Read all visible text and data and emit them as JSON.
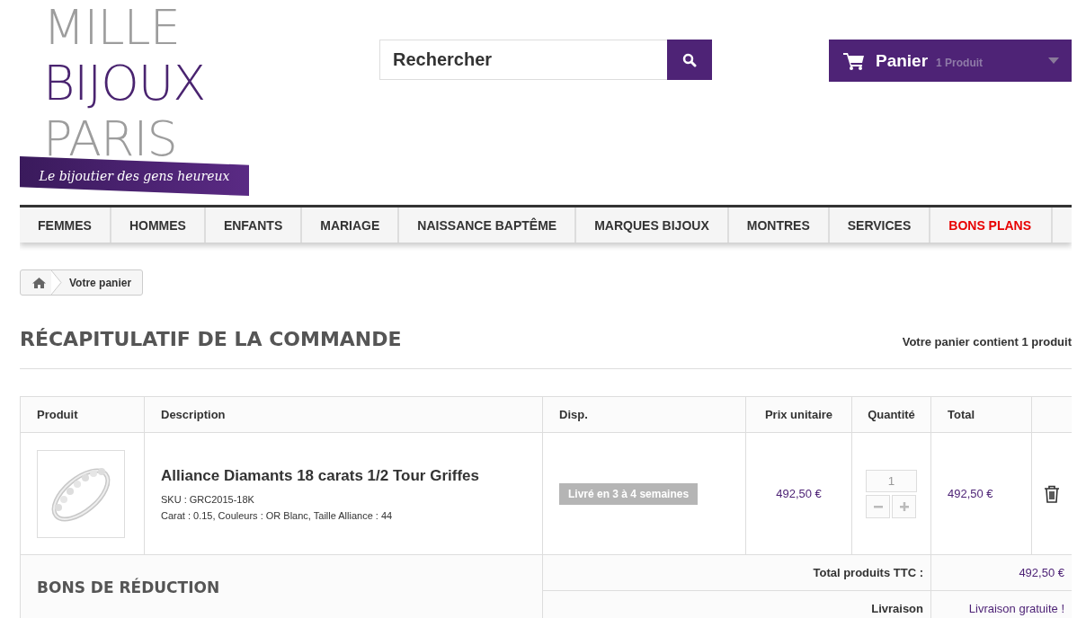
{
  "logo": {
    "lines": [
      "MILLE",
      "BIJOUX",
      "PARIS"
    ],
    "tagline": "Le bijoutier des gens heureux"
  },
  "search": {
    "placeholder": "Rechercher"
  },
  "cart": {
    "label": "Panier",
    "count": "1 Produit"
  },
  "menu": [
    {
      "label": "FEMMES",
      "kind": "normal"
    },
    {
      "label": "HOMMES",
      "kind": "normal"
    },
    {
      "label": "ENFANTS",
      "kind": "normal"
    },
    {
      "label": "MARIAGE",
      "kind": "normal"
    },
    {
      "label": "NAISSANCE BAPTÊME",
      "kind": "normal"
    },
    {
      "label": "MARQUES BIJOUX",
      "kind": "normal"
    },
    {
      "label": "MONTRES",
      "kind": "normal"
    },
    {
      "label": "SERVICES",
      "kind": "normal"
    },
    {
      "label": "BONS PLANS",
      "kind": "promo"
    }
  ],
  "breadcrumb": {
    "current": "Votre panier"
  },
  "heading": "RÉCAPITULATIF DE LA COMMANDE",
  "cart_summary": "Votre panier contient 1 produit",
  "table": {
    "columns": [
      "Produit",
      "Description",
      "Disp.",
      "Prix unitaire",
      "Quantité",
      "Total"
    ],
    "rows": [
      {
        "name": "Alliance Diamants 18 carats 1/2 Tour Griffes",
        "sku": "SKU : GRC2015-18K",
        "attributes": "Carat : 0.15, Couleurs : OR Blanc, Taille Alliance : 44",
        "availability": "Livré en 3 à 4 semaines",
        "unit_price": "492,50 €",
        "quantity": "1",
        "total": "492,50 €"
      }
    ]
  },
  "vouchers_title": "BONS DE RÉDUCTION",
  "totals": [
    {
      "label": "Total produits TTC :",
      "value": "492,50 €"
    },
    {
      "label": "Livraison",
      "value": "Livraison gratuite !"
    }
  ]
}
